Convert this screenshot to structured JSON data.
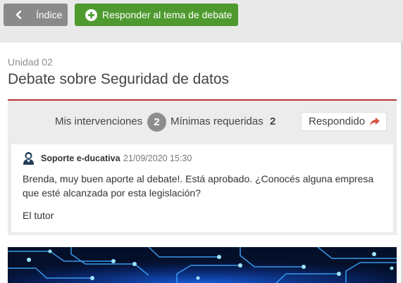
{
  "toolbar": {
    "back_label": "Índice",
    "reply_label": "Responder al tema de debate"
  },
  "header": {
    "unit": "Unidad 02",
    "title": "Debate sobre Seguridad de datos"
  },
  "stats": {
    "mis_label": "Mis intervenciones",
    "mis_count": "2",
    "min_label": "Mínimas requeridas",
    "min_count": "2",
    "status_label": "Respondido"
  },
  "comment": {
    "author": "Soporte e-ducativa",
    "date": "21/09/2020 15:30",
    "body": "Brenda, muy buen aporte al debate!. Está aprobado. ¿Conocés alguna empresa que esté alcanzada por esta legislación?",
    "signature": "El tutor"
  },
  "colors": {
    "back_button": "#8a8a8a",
    "reply_button": "#4e9a2f",
    "accent_line": "#b73232",
    "reply_arrow": "#d9503f",
    "badge": "#8d8d8d"
  },
  "icons": {
    "back": "chevron-left-icon",
    "reply": "plus-circle-icon",
    "status": "reply-arrow-icon",
    "avatar": "user-avatar-icon"
  }
}
